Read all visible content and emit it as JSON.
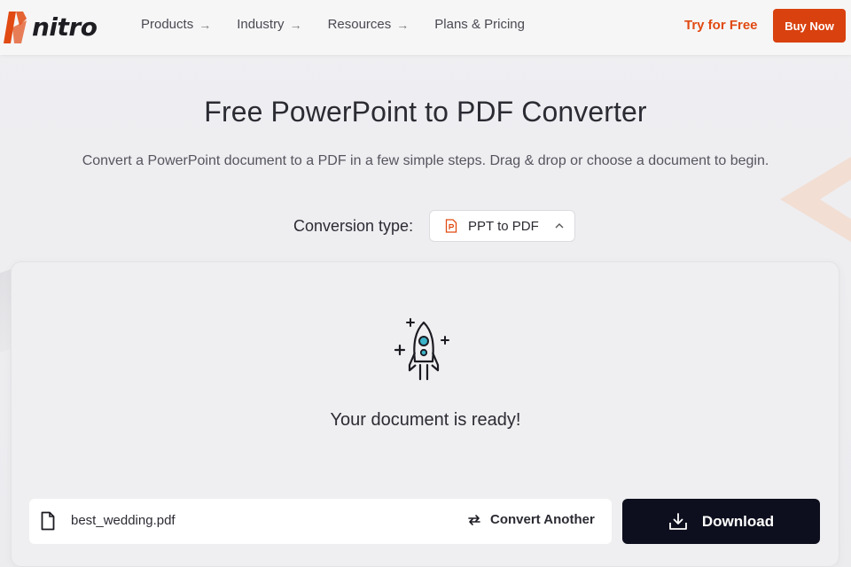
{
  "header": {
    "logo_text": "nitro",
    "nav": [
      {
        "label": "Products",
        "arrow": "→"
      },
      {
        "label": "Industry",
        "arrow": "→"
      },
      {
        "label": "Resources",
        "arrow": "→"
      },
      {
        "label": "Plans & Pricing",
        "arrow": ""
      }
    ],
    "try_free": "Try for Free",
    "buy_now": "Buy Now"
  },
  "main": {
    "title": "Free PowerPoint to PDF Converter",
    "subtitle": "Convert a PowerPoint document to a PDF in a few simple steps. Drag & drop or choose a document to begin.",
    "conversion_label": "Conversion type:",
    "conversion_value": "PPT to PDF",
    "status": "Your document is ready!",
    "file_name": "best_wedding.pdf",
    "convert_another": "Convert Another",
    "download": "Download"
  },
  "colors": {
    "brand": "#e14a12",
    "buy_button": "#d9410f",
    "download_button": "#0d0f1e",
    "rocket_accent": "#3bb3c8"
  },
  "icons": [
    "nitro-logo-icon",
    "file-ppt-icon",
    "chevron-up-icon",
    "rocket-icon",
    "document-icon",
    "swap-arrows-icon",
    "download-icon"
  ]
}
